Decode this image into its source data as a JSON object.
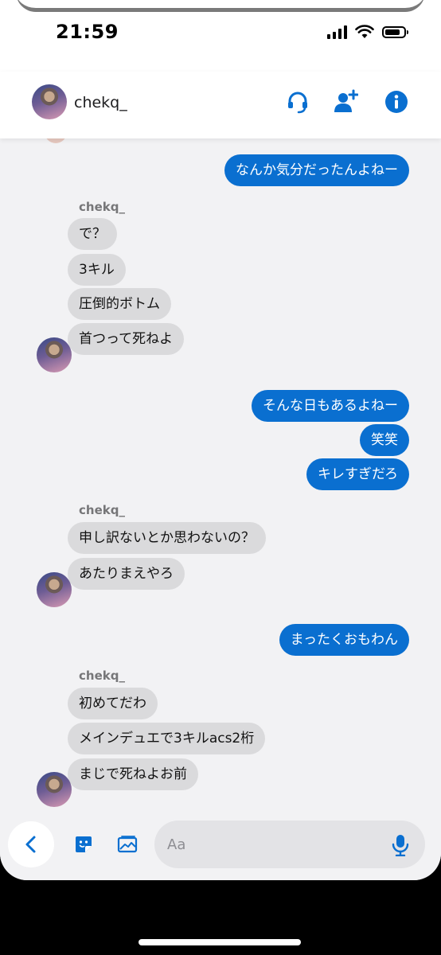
{
  "status_bar": {
    "time": "21:59",
    "battery_level": 0.8
  },
  "header": {
    "name": "chekq_",
    "icons": [
      "headset-icon",
      "add-friend-icon",
      "info-icon"
    ]
  },
  "messages": {
    "m1": "なんか気分だったんよねー",
    "s1": "chekq_",
    "m2": "で？",
    "m3": "3キル",
    "m4": "圧倒的ボトム",
    "m5": "首つって死ねよ",
    "m6": "そんな日もあるよねー",
    "m7": "笑笑",
    "m8": "キレすぎだろ",
    "s2": "chekq_",
    "m9": "申し訳ないとか思わないの？",
    "m10": "あたりまえやろ",
    "m11": "まったくおもわん",
    "s3": "chekq_",
    "m12": "初めてだわ",
    "m13": "メインデュエで3キルacs2桁",
    "m14": "まじで死ねよお前"
  },
  "composer": {
    "placeholder": "Aa",
    "icons": [
      "back-chevron-icon",
      "sticker-icon",
      "image-icon",
      "microphone-icon"
    ]
  },
  "colors": {
    "accent": "#0a6fd0",
    "incoming_bubble": "#dadadc",
    "background": "#f2f2f4"
  }
}
